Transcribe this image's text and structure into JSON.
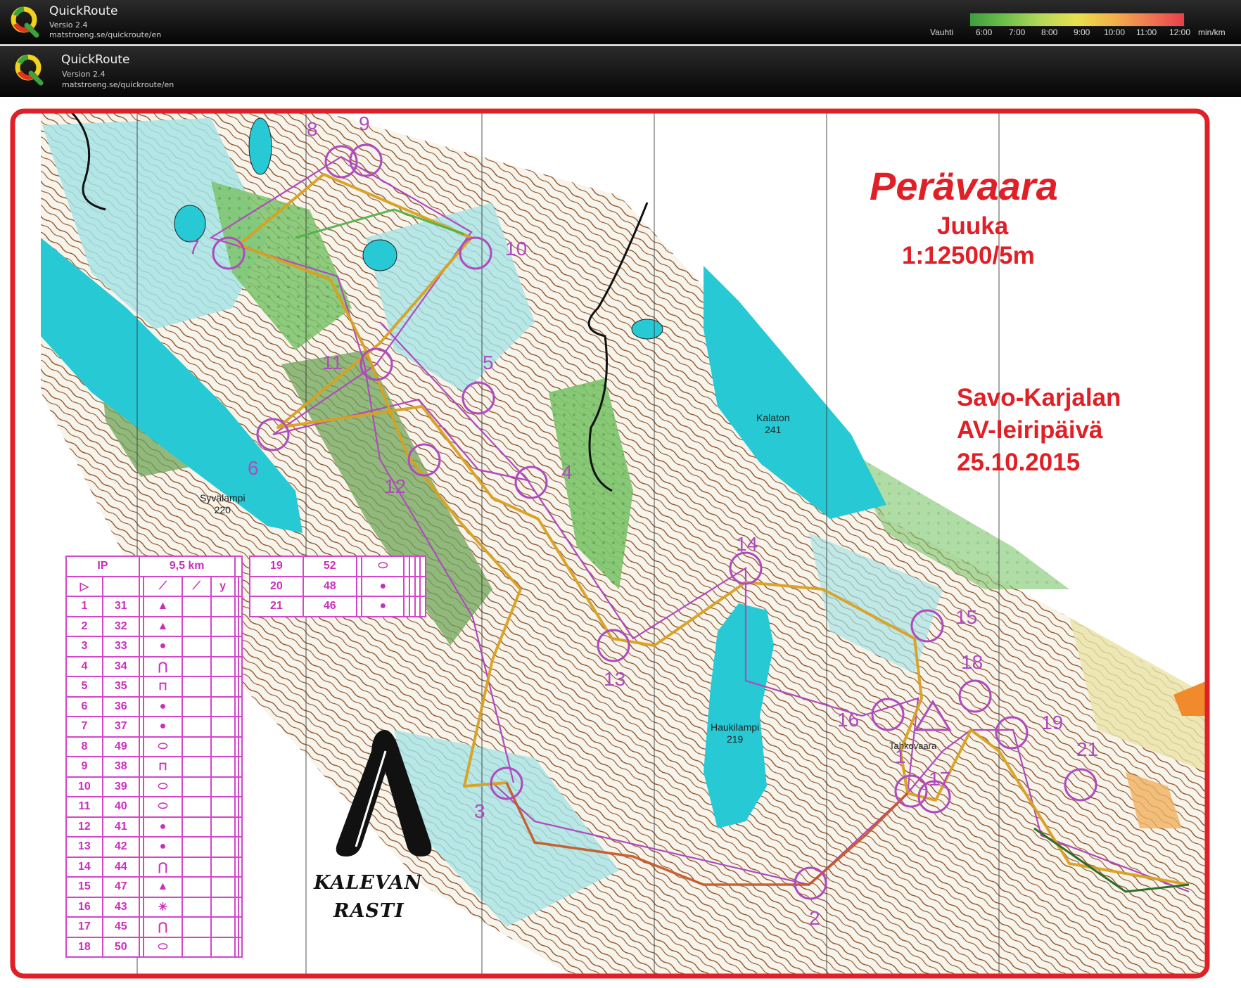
{
  "header_top": {
    "app_name": "QuickRoute",
    "version": "Versio 2.4",
    "url": "matstroeng.se/quickroute/en",
    "pace_label": "Vauhti",
    "pace_ticks": [
      "6:00",
      "7:00",
      "8:00",
      "9:00",
      "10:00",
      "11:00",
      "12:00"
    ],
    "pace_unit": "min/km"
  },
  "header_second": {
    "app_name": "QuickRoute",
    "version": "Version 2.4",
    "url": "matstroeng.se/quickroute/en"
  },
  "map": {
    "title": "Perävaara",
    "location": "Juuka",
    "scale": "1:12500/5m",
    "event_line1": "Savo-Karjalan",
    "event_line2": "AV-leiripäivä",
    "event_date": "25.10.2015",
    "lakes": [
      {
        "name": "Kalaton",
        "elevation": "241"
      },
      {
        "name": "Syvälampi",
        "elevation": "220"
      },
      {
        "name": "Haukilampi",
        "elevation": "219"
      }
    ],
    "hill_name": "Tahkovaara",
    "control_numbers": [
      "1",
      "2",
      "3",
      "4",
      "5",
      "6",
      "7",
      "8",
      "9",
      "10",
      "11",
      "12",
      "13",
      "14",
      "15",
      "16",
      "17",
      "18",
      "19",
      "21"
    ],
    "logo_line1": "KALEVAN",
    "logo_line2": "RASTI",
    "colors": {
      "frame": "#e01f26",
      "course": "#b04abf",
      "water": "#26c9d4",
      "vegetation": "#4cab47",
      "contour": "#8b4a1e"
    }
  },
  "description_sheet": {
    "class": "IP",
    "length": "9,5 km",
    "rows": [
      {
        "n": "1",
        "code": "31"
      },
      {
        "n": "2",
        "code": "32"
      },
      {
        "n": "3",
        "code": "33"
      },
      {
        "n": "4",
        "code": "34"
      },
      {
        "n": "5",
        "code": "35"
      },
      {
        "n": "6",
        "code": "36"
      },
      {
        "n": "7",
        "code": "37"
      },
      {
        "n": "8",
        "code": "49"
      },
      {
        "n": "9",
        "code": "38"
      },
      {
        "n": "10",
        "code": "39"
      },
      {
        "n": "11",
        "code": "40"
      },
      {
        "n": "12",
        "code": "41"
      },
      {
        "n": "13",
        "code": "42"
      },
      {
        "n": "14",
        "code": "44"
      },
      {
        "n": "15",
        "code": "47"
      },
      {
        "n": "16",
        "code": "43"
      },
      {
        "n": "17",
        "code": "45"
      },
      {
        "n": "18",
        "code": "50"
      }
    ],
    "rows2": [
      {
        "n": "19",
        "code": "52"
      },
      {
        "n": "20",
        "code": "48"
      },
      {
        "n": "21",
        "code": "46"
      }
    ]
  }
}
